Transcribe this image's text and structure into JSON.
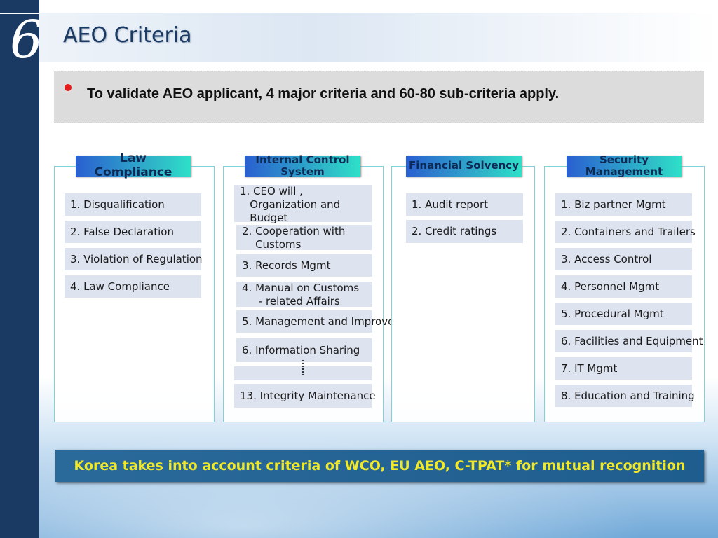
{
  "slide": {
    "number": "6",
    "title": "AEO Criteria"
  },
  "banner": {
    "text": "To validate AEO applicant, 4 major criteria and 60-80 sub-criteria apply."
  },
  "columns": [
    {
      "label": "Law\nCompliance",
      "items": [
        "1. Disqualification",
        "2. False Declaration",
        "3. Violation of  Regulation",
        "4. Law Compliance"
      ]
    },
    {
      "label": "Internal Control\nSystem",
      "items": [
        "1. CEO will ,\n   Organization and\n   Budget",
        "2. Cooperation with\n    Customs",
        "3. Records  Mgmt",
        "4. Manual on Customs\n     - related Affairs",
        "5. Management and Improve",
        "6. Information Sharing",
        "13. Integrity  Maintenance"
      ]
    },
    {
      "label": "Financial Solvency",
      "items": [
        "1. Audit report",
        "2. Credit ratings"
      ]
    },
    {
      "label": "Security\nManagement",
      "items": [
        "1. Biz partner Mgmt",
        "2. Containers and Trailers",
        "3. Access Control",
        "4. Personnel Mgmt",
        "5. Procedural Mgmt",
        "6. Facilities and Equipment",
        "7. IT Mgmt",
        "8. Education and Training"
      ]
    }
  ],
  "footer": {
    "text": "Korea takes into account criteria of WCO, EU AEO, C-TPAT* for mutual recognition"
  },
  "colors": {
    "sidebar": "#1b3a63",
    "bullet": "#e31c1c",
    "footer_text": "#f2e82a"
  }
}
